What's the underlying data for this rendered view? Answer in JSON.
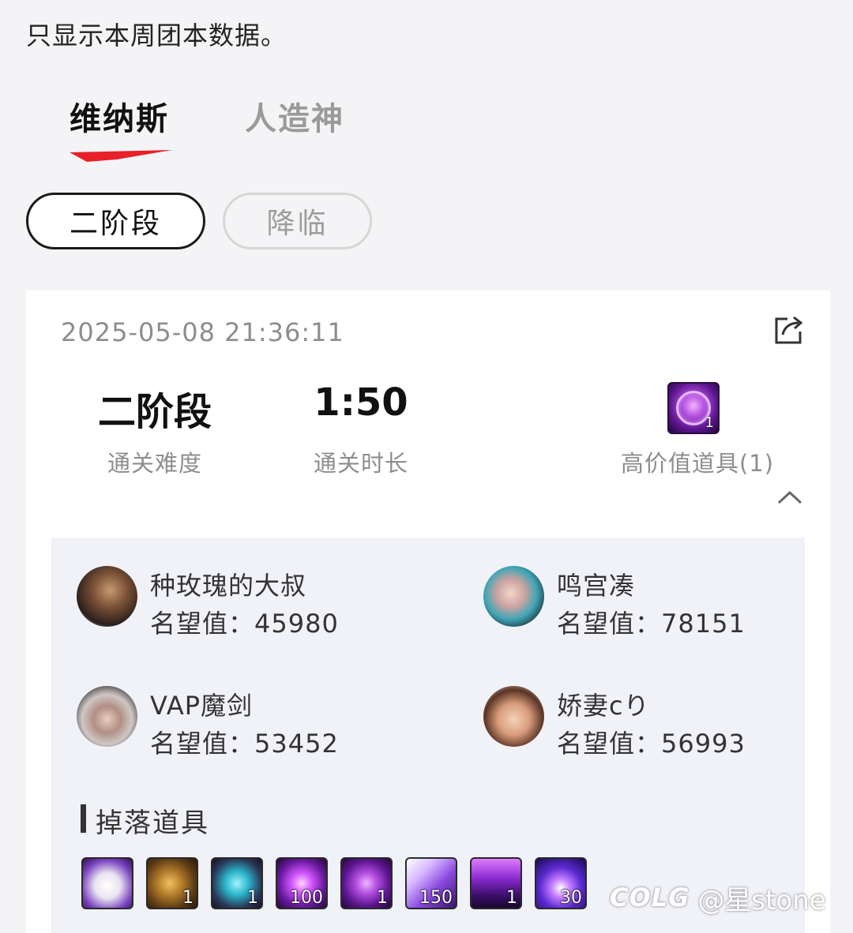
{
  "page_note": "只显示本周团本数据。",
  "tabs": [
    {
      "label": "维纳斯",
      "active": true
    },
    {
      "label": "人造神",
      "active": false
    }
  ],
  "stages": [
    {
      "label": "二阶段",
      "active": true
    },
    {
      "label": "降临",
      "active": false
    }
  ],
  "accent_color": "#e8202a",
  "record": {
    "datetime": "2025-05-08 21:36:11",
    "difficulty_value": "二阶段",
    "difficulty_label": "通关难度",
    "duration_value": "1:50",
    "duration_label": "通关时长",
    "high_value_label": "高价值道具(1)",
    "high_value_count": "1",
    "players": [
      {
        "name": "种玫瑰的大叔",
        "fame": "名望值：45980"
      },
      {
        "name": "鸣宫凑",
        "fame": "名望值：78151"
      },
      {
        "name": "VAP魔剑",
        "fame": "名望值：53452"
      },
      {
        "name": "娇妻cり",
        "fame": "名望值：56993"
      }
    ],
    "drops_title": "掉落道具",
    "drops": [
      {
        "icon": "purple-pants-icon",
        "qty": ""
      },
      {
        "icon": "gold-ore-icon",
        "qty": "1"
      },
      {
        "icon": "cyan-wing-icon",
        "qty": "1"
      },
      {
        "icon": "purple-orb-icon",
        "qty": "100"
      },
      {
        "icon": "purple-emblem-icon",
        "qty": "1"
      },
      {
        "icon": "violet-crystal-icon",
        "qty": "150"
      },
      {
        "icon": "purple-chest-icon",
        "qty": "1"
      },
      {
        "icon": "purple-flame-icon",
        "qty": "30"
      }
    ]
  },
  "watermark": {
    "logo": "COLG",
    "handle": "@星stone"
  }
}
